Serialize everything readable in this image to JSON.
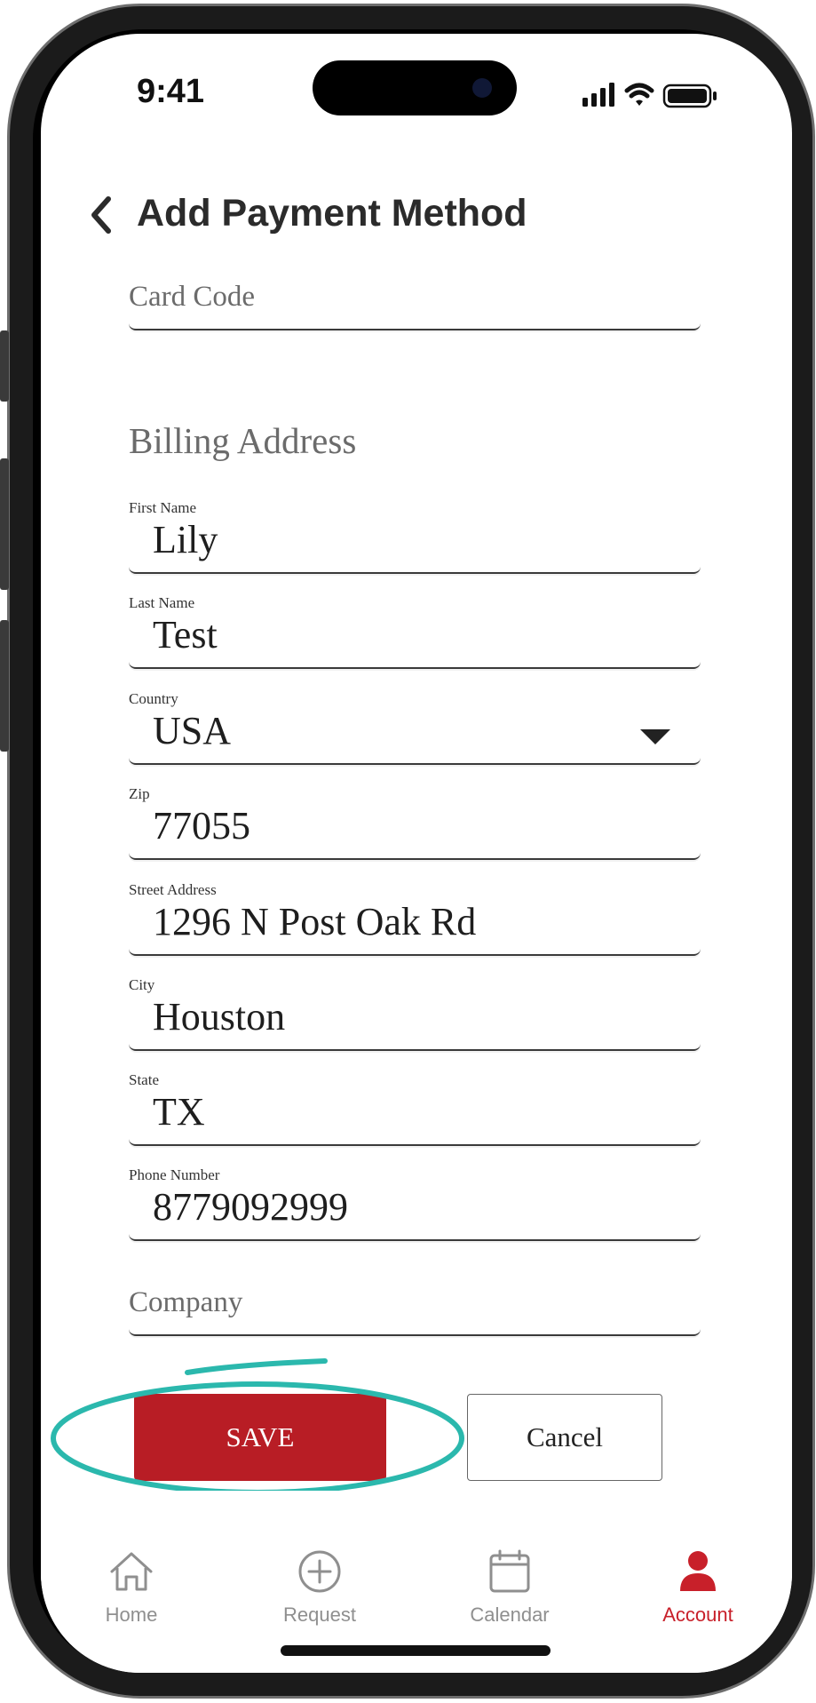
{
  "status_bar": {
    "time": "9:41"
  },
  "header": {
    "title": "Add Payment Method"
  },
  "form": {
    "card_code": {
      "placeholder": "Card Code"
    },
    "section_title": "Billing Address",
    "first_name": {
      "label": "First Name",
      "value": "Lily"
    },
    "last_name": {
      "label": "Last Name",
      "value": "Test"
    },
    "country": {
      "label": "Country",
      "value": "USA"
    },
    "zip": {
      "label": "Zip",
      "value": "77055"
    },
    "street": {
      "label": "Street Address",
      "value": "1296 N Post Oak Rd"
    },
    "city": {
      "label": "City",
      "value": "Houston"
    },
    "state": {
      "label": "State",
      "value": "TX"
    },
    "phone": {
      "label": "Phone Number",
      "value": "8779092999"
    },
    "company": {
      "placeholder": "Company"
    }
  },
  "actions": {
    "save_label": "SAVE",
    "cancel_label": "Cancel"
  },
  "tabs": [
    {
      "label": "Home",
      "icon": "home-icon"
    },
    {
      "label": "Request",
      "icon": "plus-circle-icon"
    },
    {
      "label": "Calendar",
      "icon": "calendar-icon"
    },
    {
      "label": "Account",
      "icon": "person-icon",
      "active": true
    }
  ],
  "colors": {
    "brand_red": "#b81d25",
    "annotation_teal": "#2bb8ad",
    "tab_inactive": "#8f8f8f"
  }
}
